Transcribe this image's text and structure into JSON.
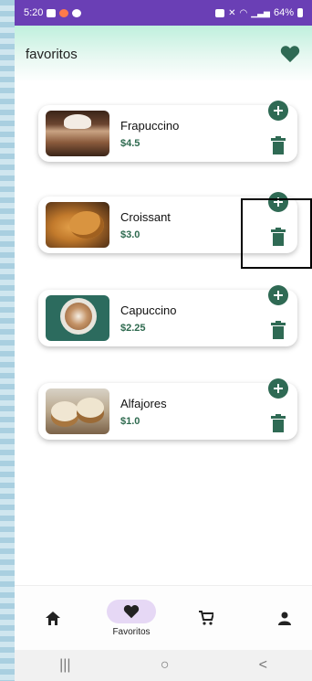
{
  "status": {
    "time": "5:20",
    "battery": "64%",
    "colors": {
      "bar": "#6a3fb5"
    }
  },
  "header": {
    "title": "favoritos",
    "heart_icon": "heart-icon"
  },
  "favorites": [
    {
      "name": "Frapuccino",
      "price": "$4.5"
    },
    {
      "name": "Croissant",
      "price": "$3.0"
    },
    {
      "name": "Capuccino",
      "price": "$2.25"
    },
    {
      "name": "Alfajores",
      "price": "$1.0"
    }
  ],
  "nav": {
    "items": [
      {
        "icon": "home-icon",
        "label": ""
      },
      {
        "icon": "heart-icon",
        "label": "Favoritos",
        "active": true
      },
      {
        "icon": "cart-icon",
        "label": ""
      },
      {
        "icon": "person-icon",
        "label": ""
      }
    ]
  },
  "system_nav": {
    "recent": "|||",
    "home": "○",
    "back": "<"
  },
  "accent": "#2f6a54"
}
